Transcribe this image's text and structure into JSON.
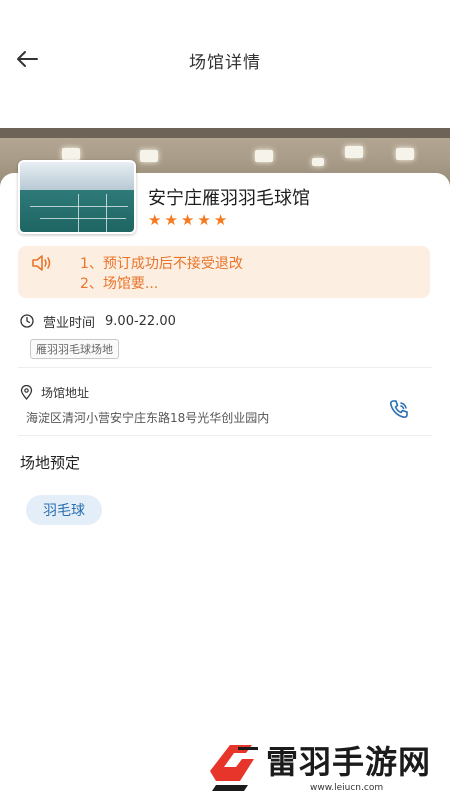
{
  "header": {
    "title": "场馆详情",
    "back_icon": "arrow-left-icon"
  },
  "venue": {
    "name": "安宁庄雁羽羽毛球馆",
    "rating_stars": 5,
    "star_color": "#f47a1f"
  },
  "notice": {
    "line1": "1、预订成功后不接受退改",
    "line2": "2、场馆要...",
    "text_color": "#e8752a",
    "background": "#fdeee2"
  },
  "hours": {
    "label": "营业时间",
    "value": "9.00-22.00"
  },
  "tag": "雁羽羽毛球场地",
  "address": {
    "label": "场馆地址",
    "text": "海淀区清河小营安宁庄东路18号光华创业园内",
    "phone_icon": "phone-icon",
    "phone_color": "#2a6fb0"
  },
  "booking": {
    "title": "场地预定",
    "sports": [
      "羽毛球"
    ],
    "chip_bg": "#e4eef8",
    "chip_color": "#2a6fb0"
  },
  "watermark": {
    "brand": "雷羽手游网",
    "url": "www.leiucn.com"
  }
}
